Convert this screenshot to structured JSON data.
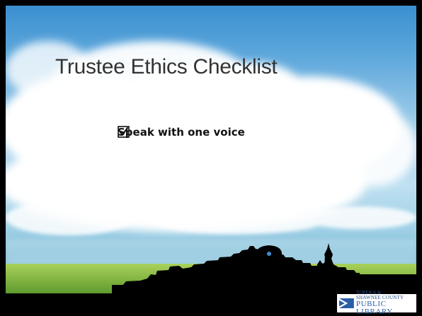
{
  "slide": {
    "title": "Trustee Ethics Checklist",
    "checklist": [
      {
        "label": "Speak with one voice",
        "checked": true,
        "icon": "checked-box-icon"
      }
    ]
  },
  "logo": {
    "line1": "TOPEKA &",
    "line2": "SHAWNEE COUNTY",
    "line3": "PUBLIC LIBRARY",
    "icon": "library-logo-mark-icon",
    "colors": {
      "primary": "#2a5ea8"
    }
  },
  "colors": {
    "sky_top": "#3a8fd0",
    "cloud": "#ffffff",
    "field": "#8fc24a",
    "silhouette": "#000000"
  }
}
